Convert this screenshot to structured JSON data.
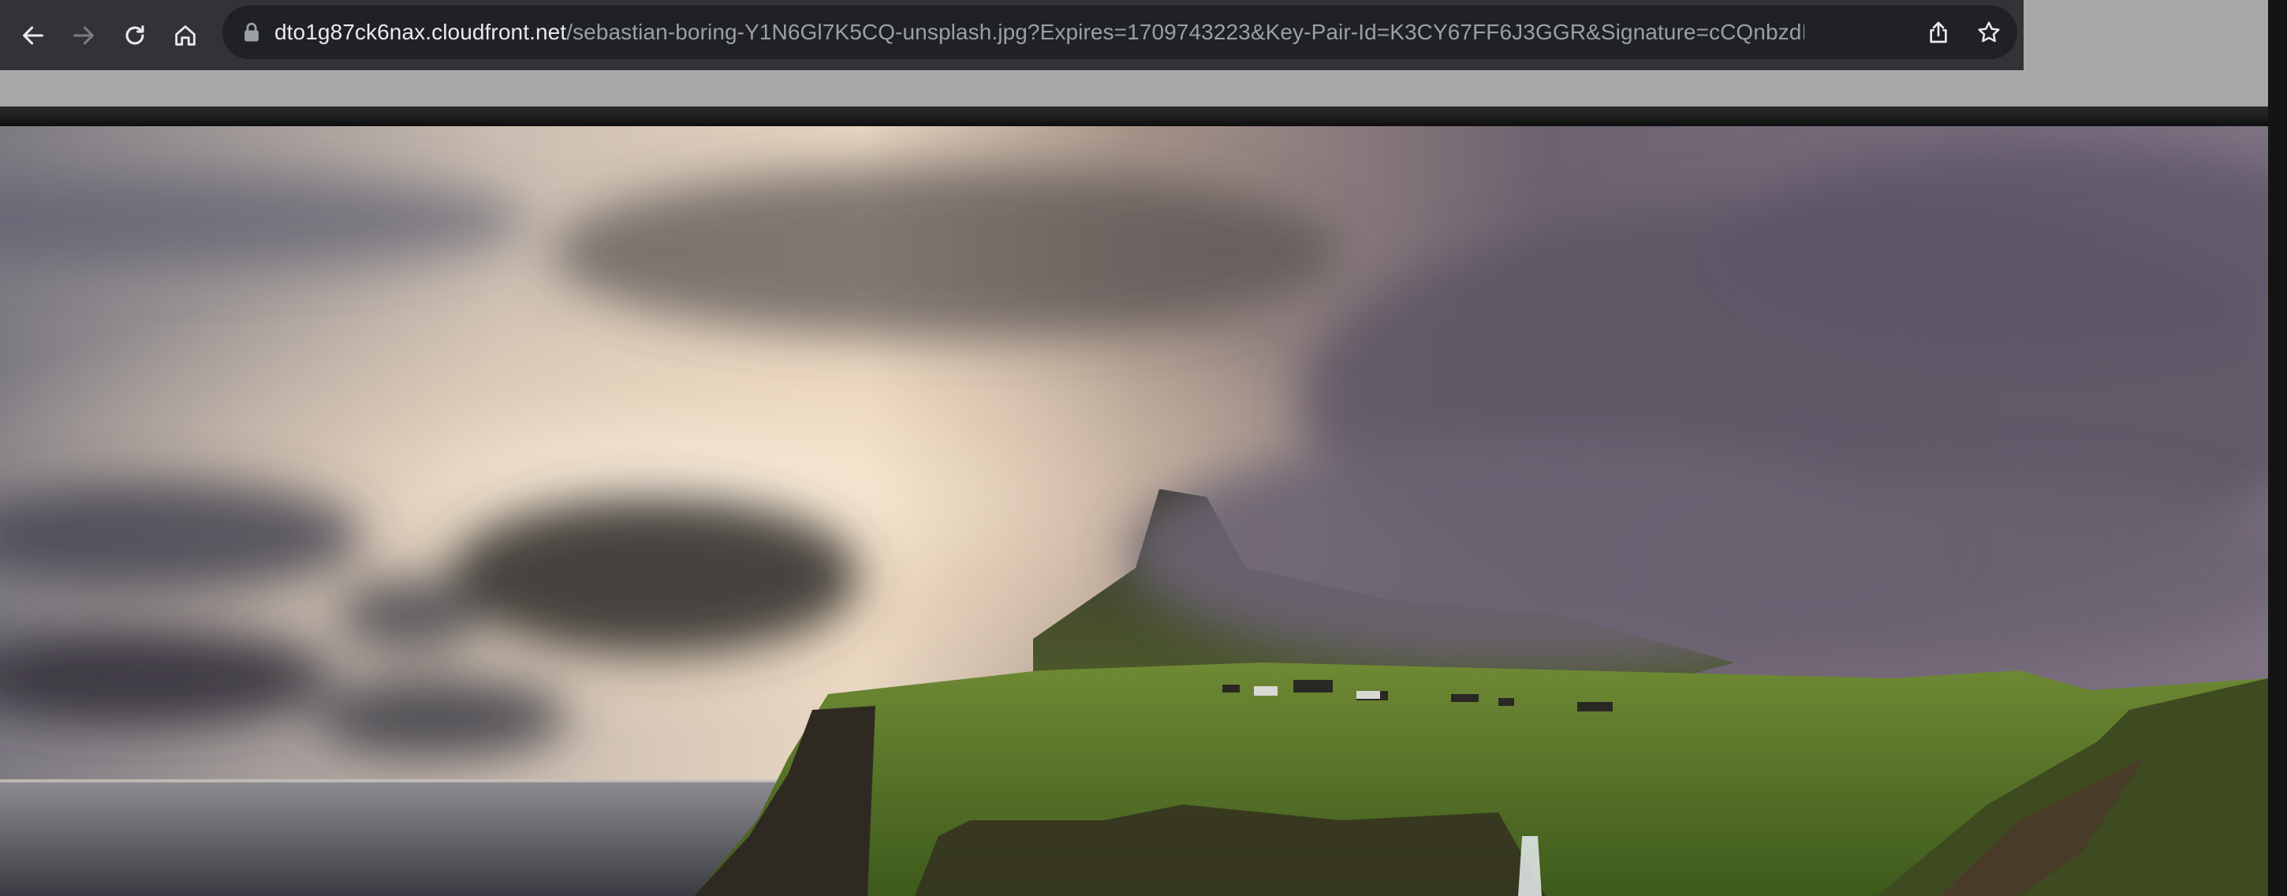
{
  "browser": {
    "url_host": "dto1g87ck6nax.cloudfront.net",
    "url_rest": "/sebastian-boring-Y1N6Gl7K5CQ-unsplash.jpg?Expires=1709743223&Key-Pair-Id=K3CY67FF6J3GGR&Signature=cCQnbzdI...",
    "icons": {
      "back": "back-arrow-icon",
      "forward": "forward-arrow-icon",
      "reload": "reload-icon",
      "home": "home-icon",
      "lock": "lock-icon",
      "share": "share-icon",
      "bookmark": "star-icon"
    }
  },
  "image": {
    "subject": "landscape-photo"
  },
  "colors": {
    "toolbar": "#323336",
    "omnibox": "#202124",
    "url_host": "#e8eaed",
    "url_rest": "#9aa0a6"
  }
}
